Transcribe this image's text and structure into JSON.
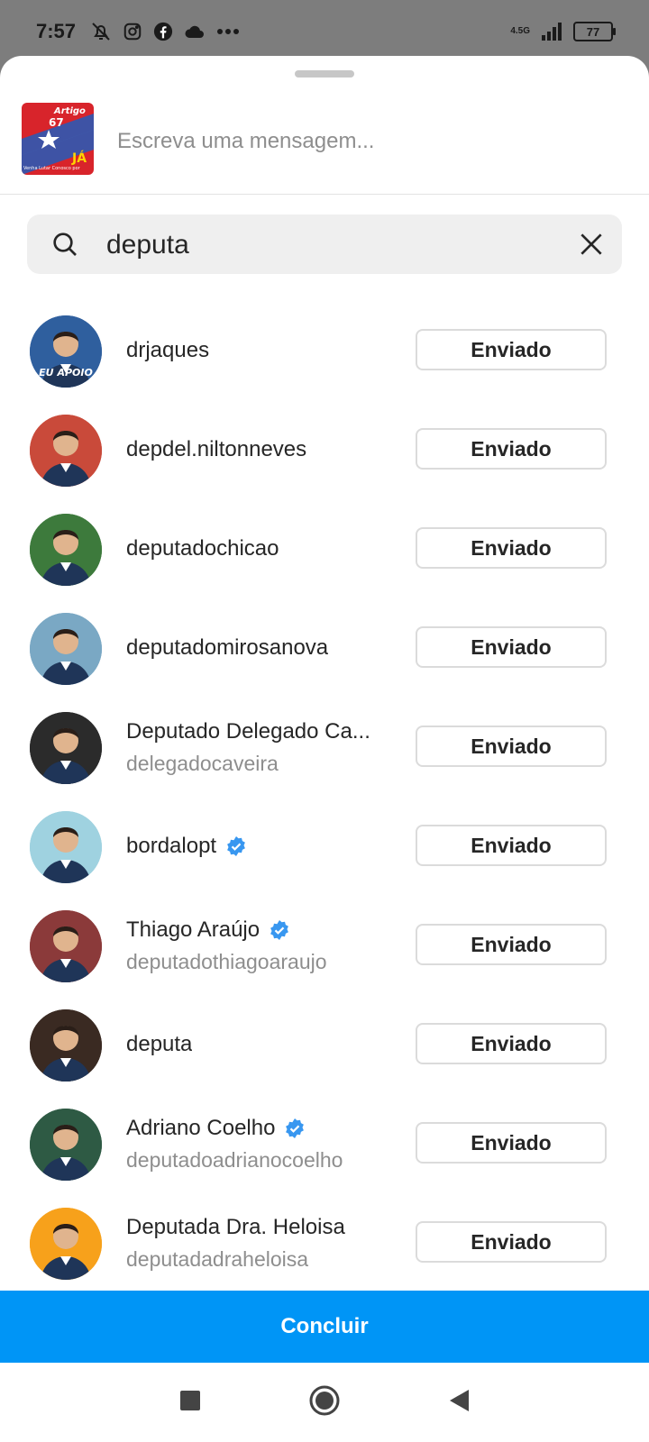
{
  "status_bar": {
    "time": "7:57",
    "icons": [
      "alarm-off-icon",
      "instagram-icon",
      "facebook-icon",
      "cloud-icon",
      "more-icon"
    ],
    "network": "4.5G",
    "battery": "77"
  },
  "share_sheet": {
    "post_thumbnail": {
      "title_word": "Artigo",
      "number": "67",
      "accent": "JÁ",
      "small_text": "Venha Lutar Conosco por"
    },
    "message_placeholder": "Escreva uma mensagem...",
    "search": {
      "value": "deputa",
      "icon": "search-icon",
      "clear_icon": "close-icon"
    },
    "recipients": [
      {
        "primary": "drjaques",
        "secondary": "",
        "verified": false,
        "button": "Enviado",
        "avatar_color": "#2f5f9e",
        "avatar_text": "EU APOIO"
      },
      {
        "primary": "depdel.niltonneves",
        "secondary": "",
        "verified": false,
        "button": "Enviado",
        "avatar_color": "#c94a3a",
        "avatar_text": ""
      },
      {
        "primary": "deputadochicao",
        "secondary": "",
        "verified": false,
        "button": "Enviado",
        "avatar_color": "#3d7a3c",
        "avatar_text": ""
      },
      {
        "primary": "deputadomirosanova",
        "secondary": "",
        "verified": false,
        "button": "Enviado",
        "avatar_color": "#7aa8c4",
        "avatar_text": ""
      },
      {
        "primary": "Deputado Delegado Ca...",
        "secondary": "delegadocaveira",
        "verified": false,
        "button": "Enviado",
        "avatar_color": "#2b2b2b",
        "avatar_text": ""
      },
      {
        "primary": "bordalopt",
        "secondary": "",
        "verified": true,
        "button": "Enviado",
        "avatar_color": "#9fd2e0",
        "avatar_text": ""
      },
      {
        "primary": "Thiago Araújo",
        "secondary": "deputadothiagoaraujo",
        "verified": true,
        "button": "Enviado",
        "avatar_color": "#8b3a3a",
        "avatar_text": ""
      },
      {
        "primary": "deputa",
        "secondary": "",
        "verified": false,
        "button": "Enviado",
        "avatar_color": "#3a2a22",
        "avatar_text": ""
      },
      {
        "primary": "Adriano Coelho",
        "secondary": "deputadoadrianocoelho",
        "verified": true,
        "button": "Enviado",
        "avatar_color": "#2e5a44",
        "avatar_text": ""
      },
      {
        "primary": "Deputada Dra. Heloisa",
        "secondary": "deputadadraheloisa",
        "verified": false,
        "button": "Enviado",
        "avatar_color": "#f7a11b",
        "avatar_text": ""
      }
    ],
    "done_button": "Concluir"
  },
  "nav_bar": {
    "icons": [
      "recents-square-icon",
      "home-circle-icon",
      "back-triangle-icon"
    ]
  },
  "colors": {
    "accent_blue": "#0095f6",
    "verified_blue": "#3897f0",
    "border": "#dbdbdb"
  }
}
